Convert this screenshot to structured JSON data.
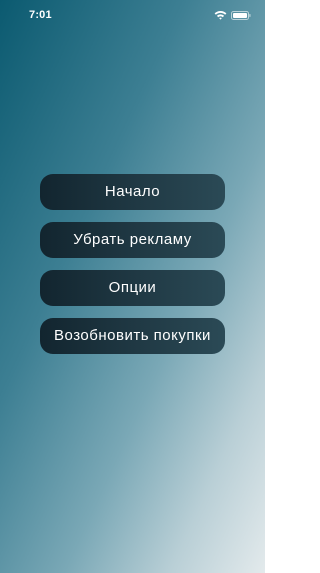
{
  "status_bar": {
    "time": "7:01",
    "icons": [
      "wifi-icon",
      "battery-icon"
    ]
  },
  "menu": {
    "buttons": [
      {
        "label": "Начало"
      },
      {
        "label": "Убрать рекламу"
      },
      {
        "label": "Опции"
      },
      {
        "label": "Возобновить покупки"
      }
    ]
  },
  "colors": {
    "gradient_top": "#0b5a70",
    "gradient_bottom": "#e3eaec",
    "button_dark": "#12252f",
    "button_light": "#2b4a56",
    "text": "#ffffff"
  }
}
